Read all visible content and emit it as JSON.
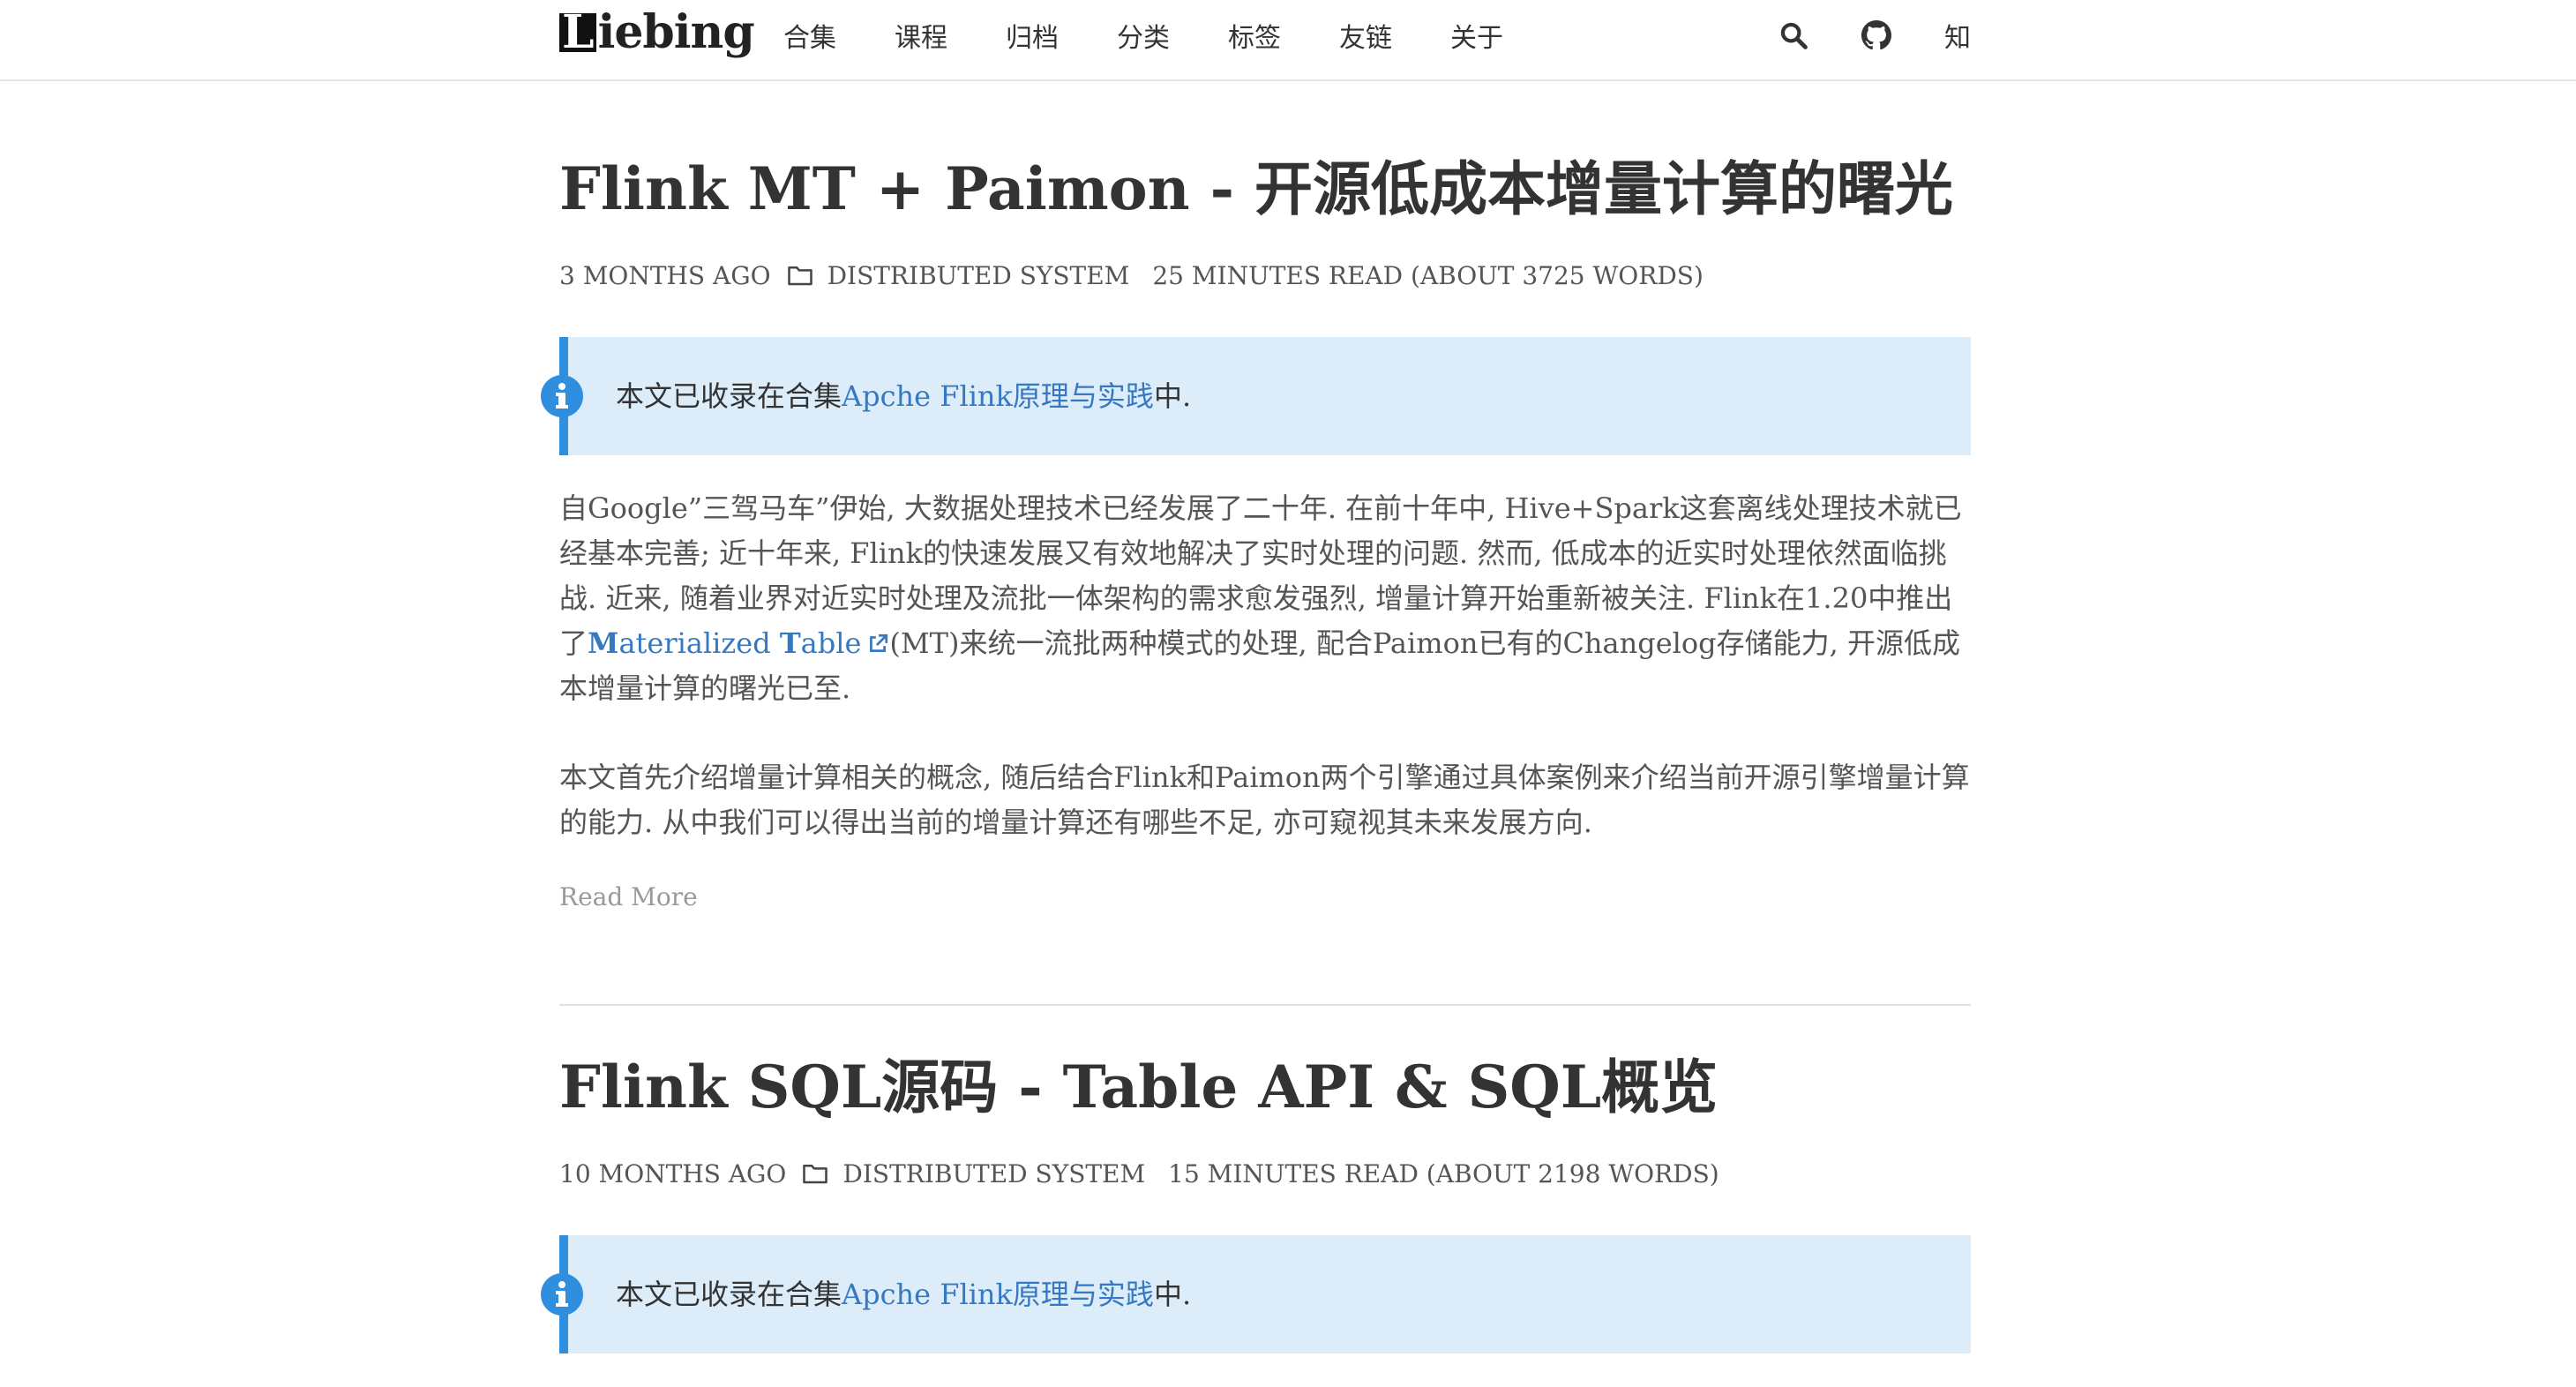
{
  "site": {
    "logo_first": "L",
    "logo_rest": "iebing"
  },
  "nav": {
    "items": [
      "合集",
      "课程",
      "归档",
      "分类",
      "标签",
      "友链",
      "关于"
    ],
    "zhihu_label": "知"
  },
  "posts": [
    {
      "title": "Flink MT + Paimon - 开源低成本增量计算的曙光",
      "age": "3 MONTHS AGO",
      "category": "DISTRIBUTED SYSTEM",
      "read_info": "25 MINUTES READ (ABOUT 3725 WORDS)",
      "notice": {
        "prefix": "本文已收录在合集",
        "link": "Apche Flink原理与实践",
        "suffix": "中."
      },
      "p1_a": "自Google”三驾马车”伊始, 大数据处理技术已经发展了二十年. 在前十年中, Hive+Spark这套离线处理技术就已经基本完善; 近十年来, Flink的快速发展又有效地解决了实时处理的问题. 然而, 低成本的近实时处理依然面临挑战. 近来, 随着业界对近实时处理及流批一体架构的需求愈发强烈, 增量计算开始重新被关注. Flink在1.20中推出了",
      "p1_link_m": "M",
      "p1_link_mid": "aterialized ",
      "p1_link_t": "T",
      "p1_link_end": "able",
      "p1_b": "(MT)来统一流批两种模式的处理, 配合Paimon已有的Changelog存储能力, 开源低成本增量计算的曙光已至.",
      "p2": "本文首先介绍增量计算相关的概念, 随后结合Flink和Paimon两个引擎通过具体案例来介绍当前开源引擎增量计算的能力. 从中我们可以得出当前的增量计算还有哪些不足, 亦可窥视其未来发展方向.",
      "read_more": "Read More"
    },
    {
      "title": "Flink SQL源码 - Table API & SQL概览",
      "age": "10 MONTHS AGO",
      "category": "DISTRIBUTED SYSTEM",
      "read_info": "15 MINUTES READ (ABOUT 2198 WORDS)",
      "notice": {
        "prefix": "本文已收录在合集",
        "link": "Apche Flink原理与实践",
        "suffix": "中."
      }
    }
  ],
  "colors": {
    "accent": "#3678c2",
    "notice_bg": "#dcedf9",
    "notice_border": "#2f8fde"
  }
}
